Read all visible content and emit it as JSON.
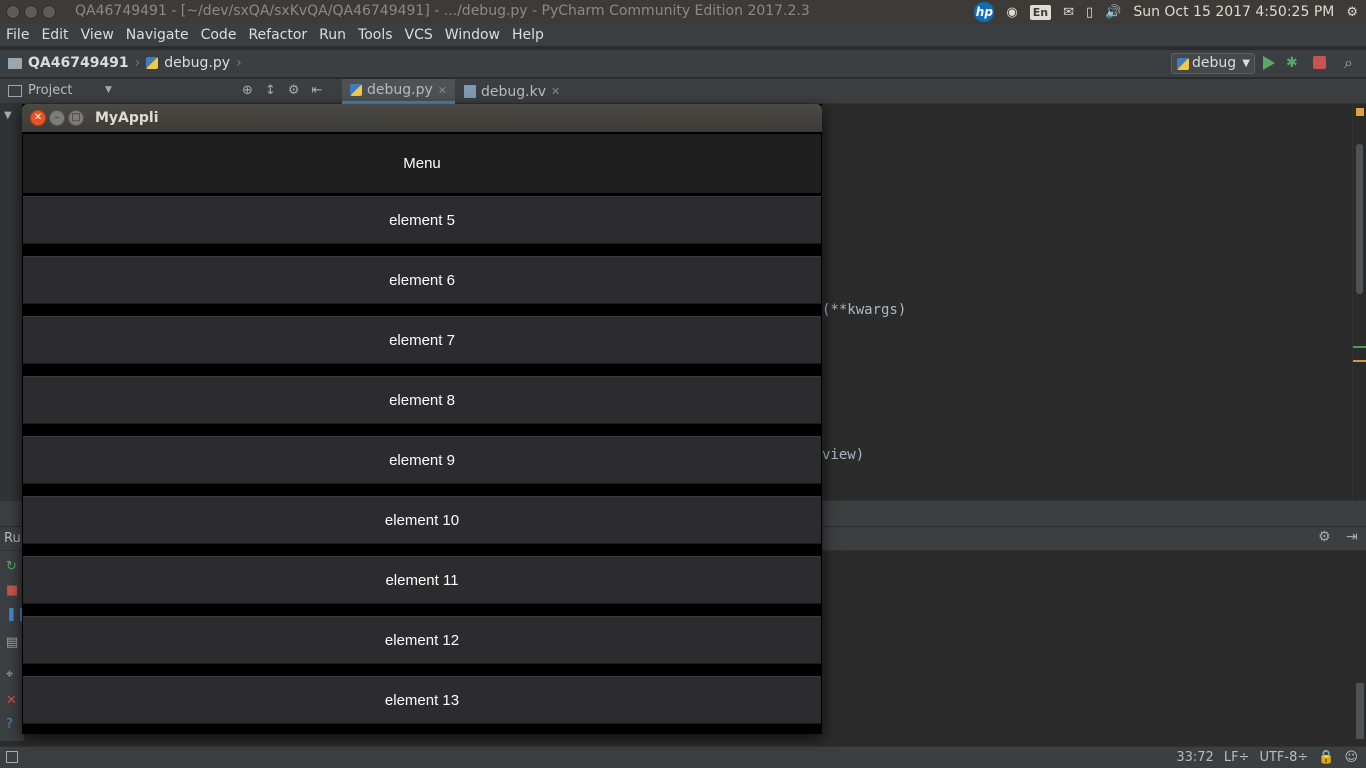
{
  "topbar": {
    "title": "QA46749491 - [~/dev/sxQA/sxKvQA/QA46749491] - .../debug.py - PyCharm Community Edition 2017.2.3",
    "keyboard": "En",
    "clock": "Sun Oct 15 2017  4:50:25 PM"
  },
  "menu": {
    "items": [
      "File",
      "Edit",
      "View",
      "Navigate",
      "Code",
      "Refactor",
      "Run",
      "Tools",
      "VCS",
      "Window",
      "Help"
    ]
  },
  "nav": {
    "project": "QA46749491",
    "file": "debug.py",
    "run_config": "debug"
  },
  "toolwindow": {
    "project_label": "Project"
  },
  "tabs": [
    {
      "label": "debug.py",
      "active": true
    },
    {
      "label": "debug.kv",
      "active": false
    }
  ],
  "editor": {
    "frag1": "(**kwargs)",
    "frag2": "view)"
  },
  "run_panel": {
    "label": "Run"
  },
  "status": {
    "position": "33:72",
    "line_sep": "LF÷",
    "encoding": "UTF-8÷"
  },
  "app": {
    "title": "MyAppli",
    "header": "Menu",
    "elements": [
      "element 5",
      "element 6",
      "element 7",
      "element 8",
      "element 9",
      "element 10",
      "element 11",
      "element 12",
      "element 13"
    ]
  },
  "colors": {
    "accent": "#4a88c7",
    "run_green": "#59a869",
    "stop_red": "#c75450",
    "ubuntu_orange": "#e95420"
  }
}
